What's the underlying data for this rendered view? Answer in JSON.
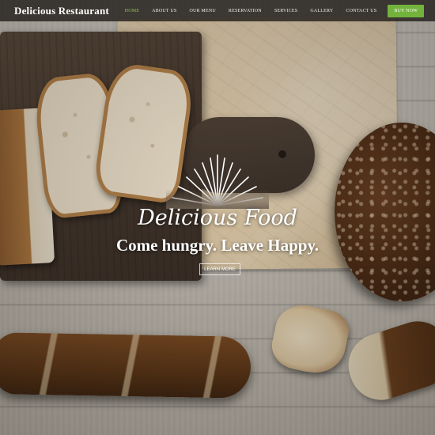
{
  "header": {
    "brand": "Delicious Restaurant",
    "nav": [
      {
        "label": "HOME",
        "active": true
      },
      {
        "label": "ABOUT US",
        "active": false
      },
      {
        "label": "OUR MENU",
        "active": false
      },
      {
        "label": "RESERVATION",
        "active": false
      },
      {
        "label": "SERVICES",
        "active": false
      },
      {
        "label": "GALLERY",
        "active": false
      },
      {
        "label": "CONTACT US",
        "active": false
      }
    ],
    "cta": "BUY NOW"
  },
  "hero": {
    "title": "Delicious Food",
    "subtitle": "Come hungry. Leave Happy.",
    "button": "LEARN MORE",
    "icon": "sunburst-icon"
  },
  "colors": {
    "accent_green": "#72b33c",
    "active_nav": "#8fc15b",
    "header_bg": "#23201c"
  }
}
